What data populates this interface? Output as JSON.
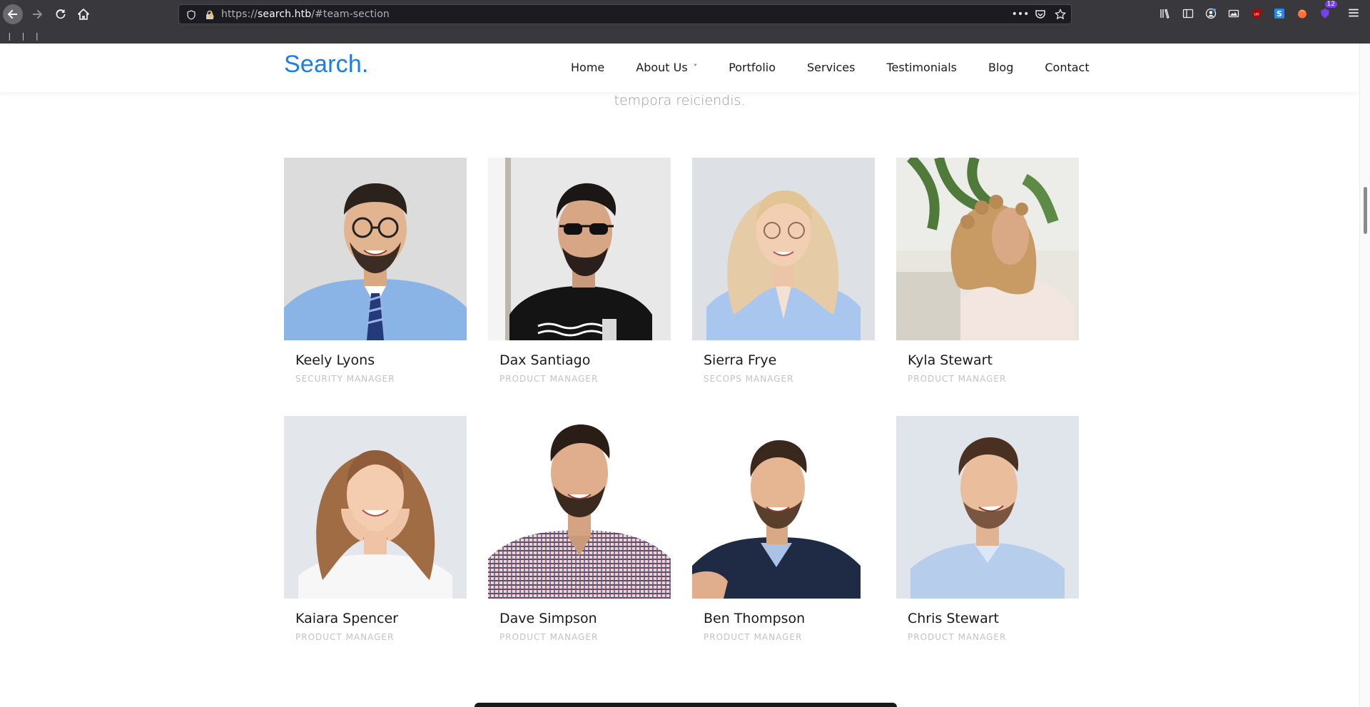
{
  "browser": {
    "url_scheme": "https://",
    "url_host": "search.htb",
    "url_path": "/#team-section",
    "bookmarks_marker": "| | |",
    "extension_badge": "12",
    "icons": [
      "back-icon",
      "forward-icon",
      "reload-icon",
      "home-icon",
      "shield-icon",
      "lock-icon",
      "more-icon",
      "pocket-icon",
      "star-icon",
      "library-icon",
      "sidebar-icon",
      "account-icon",
      "screenshot-icon",
      "ublock-icon",
      "extension-s-icon",
      "firefox-extension-icon",
      "shield-badge-icon",
      "menu-icon"
    ]
  },
  "site": {
    "logo": "Search.",
    "nav": {
      "home": "Home",
      "about": "About Us",
      "portfolio": "Portfolio",
      "services": "Services",
      "testimonials": "Testimonials",
      "blog": "Blog",
      "contact": "Contact"
    },
    "intro_tail": "tempora reiciendis.",
    "accent_color": "#1a7de6"
  },
  "team": [
    {
      "name": "Keely Lyons",
      "role": "Security Manager"
    },
    {
      "name": "Dax Santiago",
      "role": "Product Manager"
    },
    {
      "name": "Sierra Frye",
      "role": "SecOps Manager"
    },
    {
      "name": "Kyla Stewart",
      "role": "Product Manager"
    },
    {
      "name": "Kaiara Spencer",
      "role": "Product Manager"
    },
    {
      "name": "Dave Simpson",
      "role": "Product Manager"
    },
    {
      "name": "Ben Thompson",
      "role": "Product Manager"
    },
    {
      "name": "Chris Stewart",
      "role": "Product Manager"
    }
  ]
}
